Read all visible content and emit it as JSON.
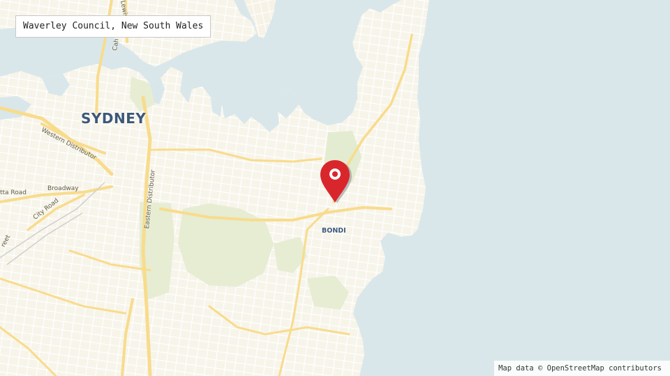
{
  "search": {
    "location_text": "Waverley Council, New South Wales"
  },
  "map": {
    "attribution": "Map data ©  OpenStreetMap contributors",
    "place_labels": {
      "city": "SYDNEY",
      "suburb": "BONDI"
    },
    "road_labels": {
      "western_distributor": "Western Distributor",
      "broadway": "Broadway",
      "city_road": "City Road",
      "eastern_distributor": "Eastern Distributor",
      "parramatta_road": "tta Road",
      "street_fragment": "reet",
      "cahill_fragment": "Cah",
      "lewis_fragment": "Lewis"
    },
    "marker": {
      "icon": "map-pin-icon",
      "color": "#d9262c"
    },
    "colors": {
      "water": "#d9e7eb",
      "land": "#f7f4ea",
      "park": "#e6edd3",
      "major_road": "#f8dc8c",
      "street": "#ffffff"
    }
  }
}
